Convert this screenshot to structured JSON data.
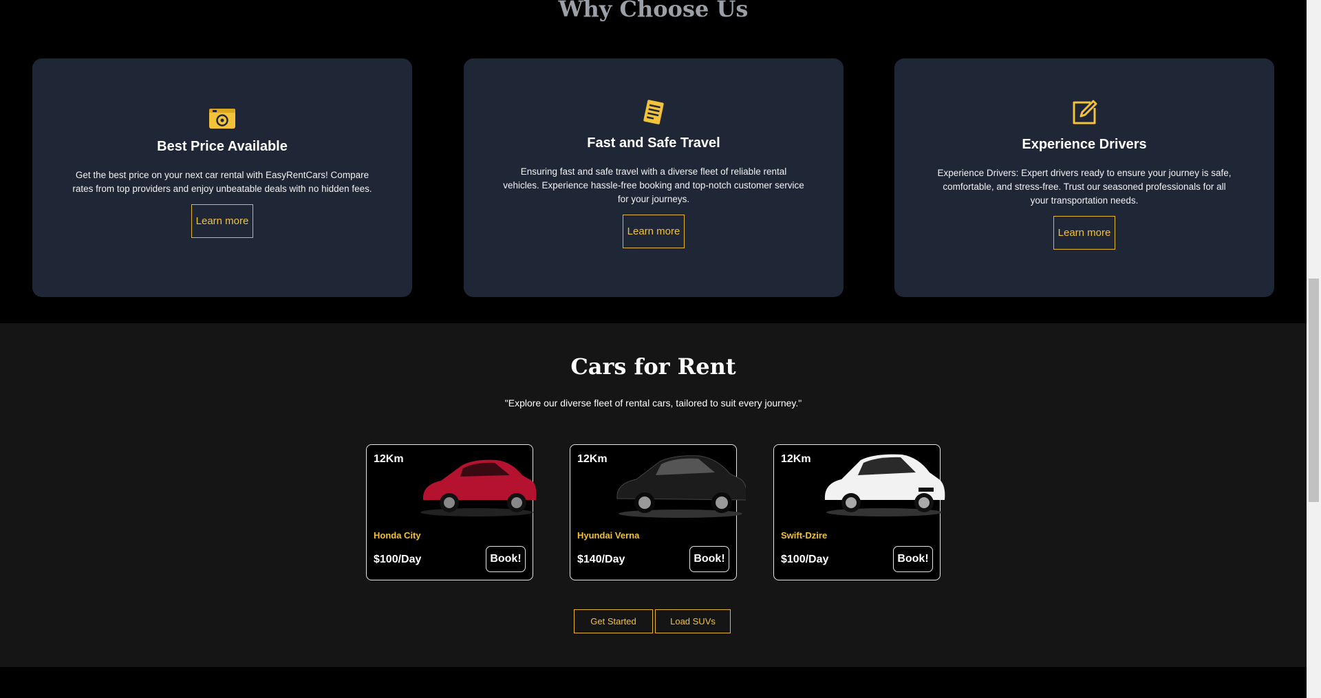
{
  "why_section": {
    "title": "Why Choose Us",
    "cards": [
      {
        "icon": "price-tag-icon",
        "title": "Best Price Available",
        "text": "Get the best price on your next car rental with EasyRentCars! Compare rates from top providers and enjoy unbeatable deals with no hidden fees.",
        "button": "Learn more"
      },
      {
        "icon": "notepad-icon",
        "title": "Fast and Safe Travel",
        "text": "Ensuring fast and safe travel with a diverse fleet of reliable rental vehicles. Experience hassle-free booking and top-notch customer service for your journeys.",
        "button": "Learn more"
      },
      {
        "icon": "edit-icon",
        "title": "Experience Drivers",
        "text": "Experience Drivers: Expert drivers ready to ensure your journey is safe, comfortable, and stress-free. Trust our seasoned professionals for all your transportation needs.",
        "button": "Learn more"
      }
    ]
  },
  "cars_section": {
    "title": "Cars for Rent",
    "subtitle": "\"Explore our diverse fleet of rental cars, tailored to suit every journey.\"",
    "cars": [
      {
        "distance": "12Km",
        "name": "Honda City",
        "price": "$100/Day",
        "book": "Book!",
        "color": "#b5122f"
      },
      {
        "distance": "12Km",
        "name": "Hyundai Verna",
        "price": "$140/Day",
        "book": "Book!",
        "color": "#151515"
      },
      {
        "distance": "12Km",
        "name": "Swift-Dzire",
        "price": "$100/Day",
        "book": "Book!",
        "color": "#f2f2f2"
      }
    ],
    "actions": {
      "get_started": "Get Started",
      "load_suvs": "Load SUVs"
    }
  },
  "colors": {
    "accent": "#f1c23a",
    "card_bg": "#1f2636",
    "section_bg": "#151515"
  }
}
